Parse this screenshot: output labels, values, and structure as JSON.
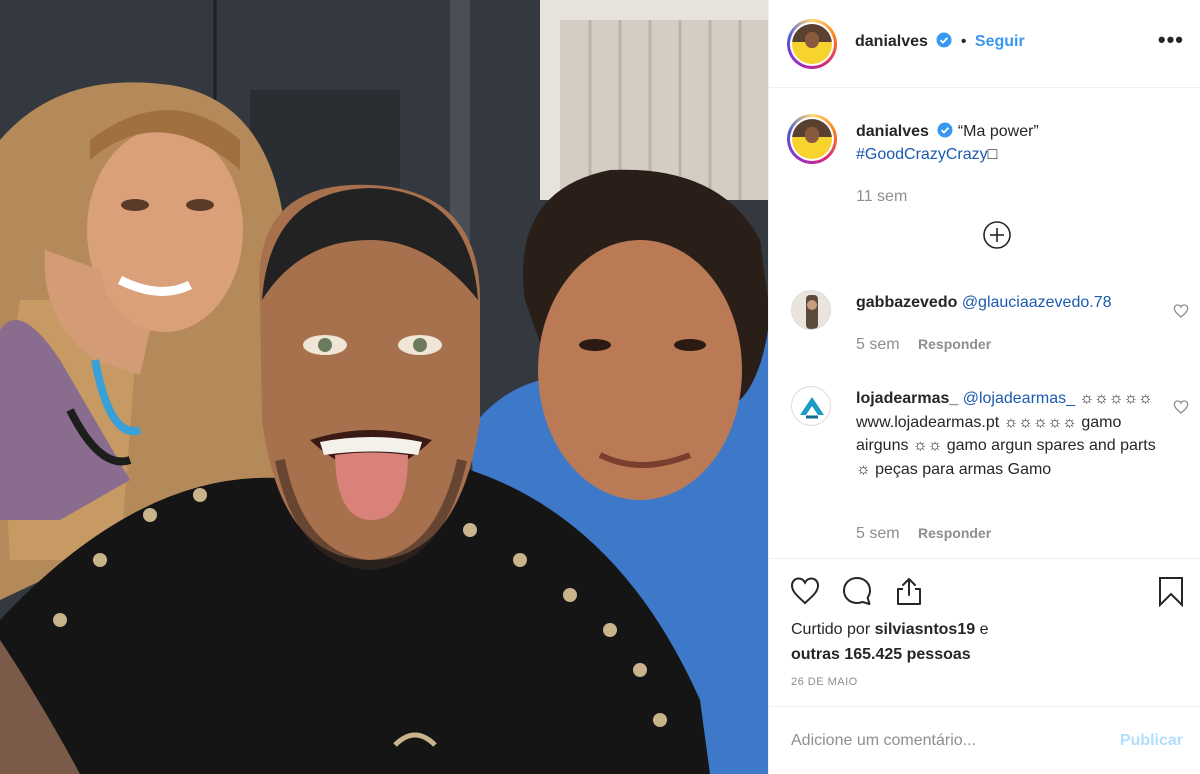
{
  "post": {
    "author": "danialves",
    "follow_label": "Seguir",
    "dot": "•",
    "more_label": "•••",
    "caption": {
      "author": "danialves",
      "text": "“Ma power”",
      "hashtag": "#GoodCrazyCrazy",
      "emoji": "□",
      "time": "11 sem"
    },
    "comments": [
      {
        "user": "gabbazevedo",
        "mention": "@glauciaazevedo.78",
        "text": "",
        "time": "5 sem",
        "reply_label": "Responder"
      },
      {
        "user": "lojadearmas_",
        "mention": "@lojadearmas_",
        "text": "☼☼☼☼☼ www.lojadearmas.pt ☼☼☼☼☼ gamo airguns ☼☼ gamo argun spares and parts ☼ peças para armas Gamo",
        "time": "5 sem",
        "reply_label": "Responder"
      }
    ],
    "likes": {
      "prefix": "Curtido por",
      "user": "silviasntos19",
      "joiner": "e",
      "others": "outras 165.425 pessoas"
    },
    "date": "26 DE MAIO",
    "add_comment_placeholder": "Adicione um comentário...",
    "publish_label": "Publicar"
  },
  "colors": {
    "link": "#3897f0",
    "verified": "#3897f0",
    "muted": "#8e8e8e",
    "publish_disabled": "#b2dffc"
  },
  "icons": [
    "verified-badge-icon",
    "more-options-icon",
    "plus-circle-icon",
    "heart-icon",
    "comment-icon",
    "share-icon",
    "bookmark-icon"
  ]
}
